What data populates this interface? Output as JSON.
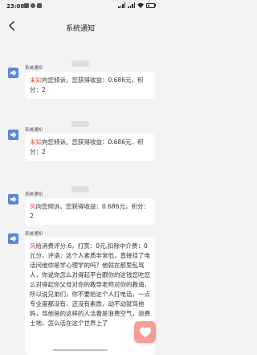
{
  "status_bar": {
    "time": "23:08",
    "battery": "20"
  },
  "header": {
    "title": "系统通知",
    "back_icon": "chevron-left-icon"
  },
  "dividers": [
    "",
    "",
    "",
    ""
  ],
  "messages": [
    {
      "sender": "系统通知",
      "name": "未知",
      "text": "向您倾诉。您获得收益：0.686元，积分：2"
    },
    {
      "sender": "系统通知",
      "name": "未知",
      "text": "向您倾诉。您获得收益：0.686元，积分：2"
    },
    {
      "sender": "系统通知",
      "name": "风",
      "text": "向您倾诉。您获得收益：0.686元，积分：2"
    },
    {
      "sender": "系统通知",
      "name": "风",
      "text": "给消费评分:6，打赏：0元,扣除中介费：0元分，评语：这个人素质非常低，直接挂了电话问他你是学心理学的吗？他就在那里乱骂人，你说你怎么对得起平台跟你的这钱您吃您么对得起你父母对你的教导老师对你的教诲，所以说兄弟们，你不要给这个人打电话，一点专业度都没有，还没有素质，动不动就骂他妈，骂他爸的这样的人活着是浪费空气，浪费土地，怎么活在这个世界上了"
    }
  ],
  "fab_icon": "heart-icon",
  "colors": {
    "name_red": "#e94d3f",
    "avatar_blue": "#5a86dc",
    "fab_pink": "#f59d96"
  }
}
